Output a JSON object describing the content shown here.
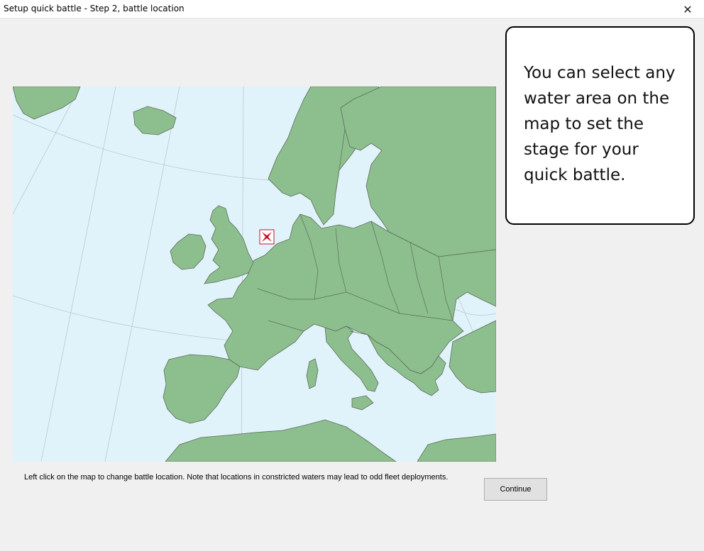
{
  "window": {
    "title": "Setup quick battle - Step 2, battle location",
    "close_glyph": "✕"
  },
  "callout": {
    "text": "You can select any water area on the map to set the stage for your quick battle."
  },
  "map": {
    "sea_color": "#e1f3fa",
    "land_color": "#8dbf8e",
    "border_color": "#5a6b5a",
    "marker_icon": "battle-marker-icon"
  },
  "footer": {
    "hint": "Left click on the map to change battle location. Note that locations in constricted waters may lead to odd fleet deployments.",
    "continue_label": "Continue"
  }
}
